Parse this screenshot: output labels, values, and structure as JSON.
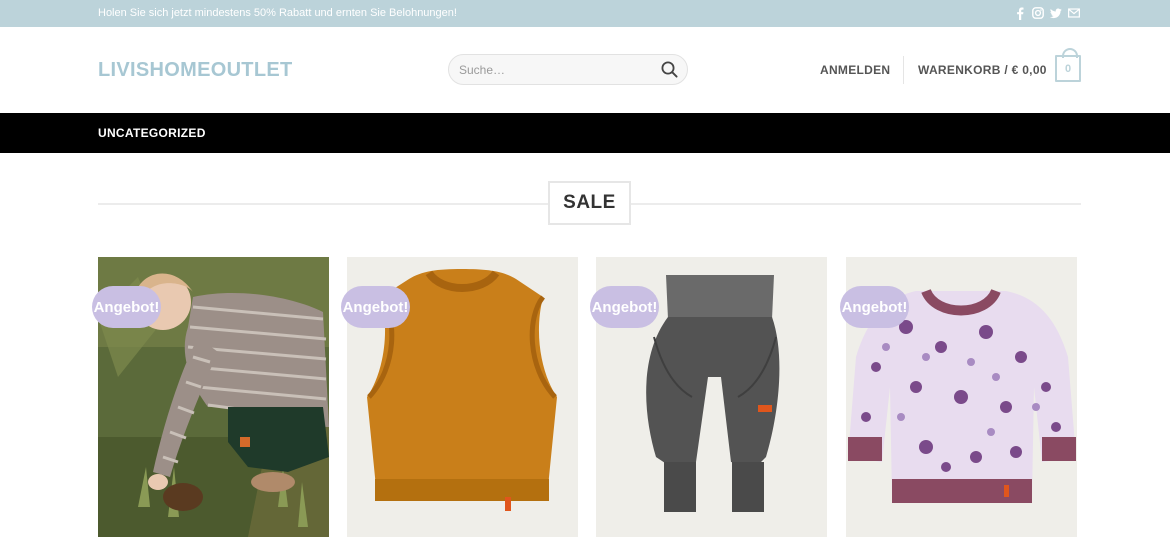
{
  "topbar": {
    "promo": "Holen Sie sich jetzt mindestens 50% Rabatt und ernten Sie Belohnungen!",
    "social_icons": [
      "facebook-icon",
      "instagram-icon",
      "twitter-icon",
      "email-icon"
    ]
  },
  "header": {
    "logo": "LIVISHOMEOUTLET",
    "search_placeholder": "Suche…",
    "login": "ANMELDEN",
    "cart_label": "WARENKORB / € 0,00",
    "cart_count": "0"
  },
  "nav": {
    "items": [
      {
        "label": "UNCATEGORIZED"
      }
    ]
  },
  "section": {
    "title": "SALE"
  },
  "products": [
    {
      "badge": "Angebot!",
      "image": "child-in-striped-sweater-photo"
    },
    {
      "badge": "Angebot!",
      "image": "mustard-sleeveless-vest"
    },
    {
      "badge": "Angebot!",
      "image": "grey-baggy-pants"
    },
    {
      "badge": "Angebot!",
      "image": "floral-sweatshirt"
    }
  ],
  "colors": {
    "topbar": "#bcd3da",
    "logo": "#a7c7d3",
    "nav": "#000000",
    "badge": "#c9bfe3"
  }
}
